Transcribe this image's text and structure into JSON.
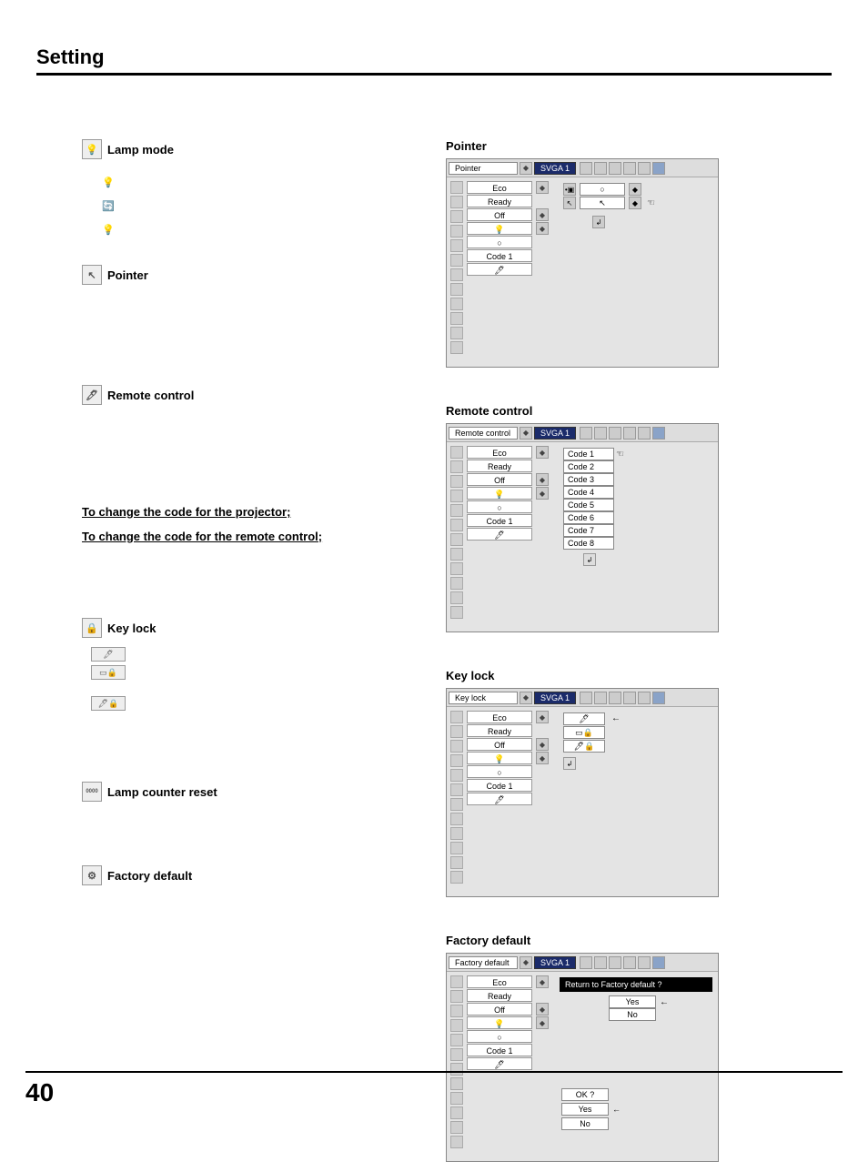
{
  "page": {
    "heading": "Setting",
    "number": "40"
  },
  "left": {
    "lamp_mode": "Lamp mode",
    "pointer": "Pointer",
    "remote_control": "Remote control",
    "link1": "To change the code for the projector;",
    "link2": "To change the code for the remote control;",
    "key_lock": "Key lock",
    "lamp_counter_reset": "Lamp counter reset",
    "factory_default": "Factory default"
  },
  "right": {
    "pointer": {
      "title": "Pointer",
      "menu_title": "Pointer",
      "svga": "SVGA 1",
      "rows": [
        "Eco",
        "Ready",
        "Off",
        "",
        "",
        "Code 1",
        ""
      ],
      "popup": [
        "",
        ""
      ]
    },
    "remote": {
      "title": "Remote control",
      "menu_title": "Remote control",
      "svga": "SVGA 1",
      "rows": [
        "Eco",
        "Ready",
        "Off",
        "",
        "",
        "Code 1",
        ""
      ],
      "codes": [
        "Code 1",
        "Code 2",
        "Code 3",
        "Code 4",
        "Code 5",
        "Code 6",
        "Code 7",
        "Code 8"
      ]
    },
    "keylock": {
      "title": "Key lock",
      "menu_title": "Key lock",
      "svga": "SVGA 1",
      "rows": [
        "Eco",
        "Ready",
        "Off",
        "",
        "",
        "Code 1",
        ""
      ]
    },
    "factory": {
      "title": "Factory default",
      "menu_title": "Factory default",
      "svga": "SVGA 1",
      "rows": [
        "Eco",
        "Ready",
        "Off",
        "",
        "",
        "Code 1",
        ""
      ],
      "banner": "Return to Factory default ?",
      "yes": "Yes",
      "no": "No",
      "ok": "OK ?"
    }
  },
  "symbols": {
    "circle": "○"
  }
}
